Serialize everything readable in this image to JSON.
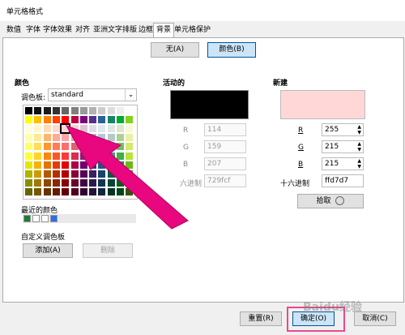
{
  "window": {
    "title": "单元格格式"
  },
  "tabs": [
    "数值",
    "字体",
    "字体效果",
    "对齐",
    "亚洲文字排版",
    "边框",
    "背景",
    "单元格保护"
  ],
  "toggle": {
    "none_label": "无(A)",
    "color_label": "颜色(B)"
  },
  "colors_section": {
    "heading": "颜色",
    "palette_label": "调色板:",
    "palette_value": "standard",
    "recent_heading": "最近的颜色",
    "recent_colors": [
      "#1e7b34",
      "#ffffff",
      "#ffffff",
      "#2a6fe8"
    ],
    "custom_heading": "自定义调色板",
    "add_label": "添加(A)",
    "delete_label": "删除"
  },
  "palette_grid": [
    [
      "#000000",
      "#111111",
      "#1c1c1c",
      "#333333",
      "#666666",
      "#808080",
      "#999999",
      "#b2b2b2",
      "#cccccc",
      "#dddddd",
      "#eeeeee",
      "#ffffff"
    ],
    [
      "#ffff00",
      "#ffbf00",
      "#ff8000",
      "#ff4000",
      "#ff0000",
      "#bf0041",
      "#800080",
      "#55308d",
      "#2a6099",
      "#158466",
      "#00a933",
      "#81d41a"
    ],
    [
      "#ffffd7",
      "#fff5ce",
      "#ffdbb6",
      "#ffd8ce",
      "#ffd7d7",
      "#f7d1d5",
      "#e0c2cd",
      "#dedce6",
      "#dee6ef",
      "#dee7e5",
      "#dde8cb",
      "#f6f9d4"
    ],
    [
      "#ffffa6",
      "#ffe994",
      "#ffb66c",
      "#ffaa95",
      "#ffa6a6",
      "#ec9ba4",
      "#bf819e",
      "#b7b3ca",
      "#b4c7dc",
      "#b3cac7",
      "#afd095",
      "#e8f2a1"
    ],
    [
      "#ffff6d",
      "#ffde59",
      "#ff972f",
      "#ff7b59",
      "#ff6d6d",
      "#e16173",
      "#a1467e",
      "#8e86ae",
      "#729fcf",
      "#81aca6",
      "#77bc65",
      "#d4ea6b"
    ],
    [
      "#ffff38",
      "#ffd428",
      "#ff860d",
      "#ff5429",
      "#ff3838",
      "#d62e4e",
      "#8d1d75",
      "#6b5e9b",
      "#5983b0",
      "#50938a",
      "#3faf46",
      "#bbe33d"
    ],
    [
      "#e6e600",
      "#f4b400",
      "#e67300",
      "#e63d00",
      "#e60000",
      "#b00045",
      "#710071",
      "#4a2b7a",
      "#1e578c",
      "#0e6f55",
      "#009e2c",
      "#6fb815"
    ],
    [
      "#b2b200",
      "#c99c00",
      "#b35900",
      "#b32f00",
      "#b30000",
      "#8b0036",
      "#580058",
      "#3a2160",
      "#18446d",
      "#0b5843",
      "#007b22",
      "#589111"
    ],
    [
      "#8c8c00",
      "#9e7a00",
      "#8c4600",
      "#8c2500",
      "#8c0000",
      "#6d002a",
      "#450045",
      "#2d1a4b",
      "#123556",
      "#084534",
      "#00611b",
      "#45720d"
    ],
    [
      "#666600",
      "#735900",
      "#663300",
      "#661b00",
      "#660000",
      "#50001f",
      "#330033",
      "#21133a",
      "#0d273f",
      "#063326",
      "#004714",
      "#335309"
    ]
  ],
  "active_section": {
    "heading": "活动的",
    "swatch_color": "#000000",
    "fields": [
      {
        "label": "R",
        "value": "114"
      },
      {
        "label": "G",
        "value": "159"
      },
      {
        "label": "B",
        "value": "207"
      }
    ],
    "hex_label": "六进制",
    "hex_value": "729fcf"
  },
  "new_section": {
    "heading": "新建",
    "swatch_color": "#ffd7d7",
    "fields": [
      {
        "label": "R",
        "value": "255"
      },
      {
        "label": "G",
        "value": "215"
      },
      {
        "label": "B",
        "value": "215"
      }
    ],
    "hex_label": "十六进制",
    "hex_value": "ffd7d7",
    "pick_label": "拾取"
  },
  "footer": {
    "reset_label": "重置(R)",
    "ok_label": "确定(O)",
    "cancel_label": "取消(C)"
  },
  "watermark": "Baidu经验"
}
